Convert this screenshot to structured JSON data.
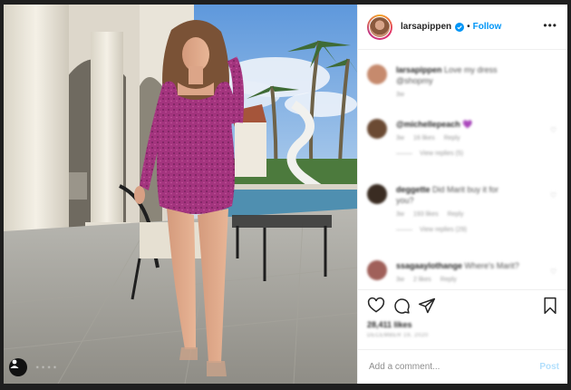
{
  "post": {
    "photo_alt": "",
    "watermark_text": "▪ ▪ ▪ ▪"
  },
  "header": {
    "username": "larsapippen",
    "separator": "•",
    "follow_label": "Follow",
    "more_label": "•••"
  },
  "comments": [
    {
      "user": "larsapippen",
      "text": "Love my dress",
      "text2": "@shopmy",
      "meta": [
        "3w"
      ],
      "replies": "",
      "avatar_color": "#c68a6d"
    },
    {
      "user": "@michellepeach",
      "text": "💜",
      "text2": "",
      "meta": [
        "3w",
        "16 likes",
        "Reply"
      ],
      "replies": "View replies (5)",
      "avatar_color": "#6b4a33"
    },
    {
      "user": "deggette",
      "text": "Did Marit buy it for",
      "text2": "you?",
      "meta": [
        "3w",
        "193 likes",
        "Reply"
      ],
      "replies": "View replies (29)",
      "avatar_color": "#3a2c22"
    },
    {
      "user": "ssagaaylothange",
      "text": "Where's Marit?",
      "text2": "",
      "meta": [
        "3w",
        "2 likes",
        "Reply"
      ],
      "replies": "",
      "avatar_color": "#a0605a"
    }
  ],
  "likes": "28,411 likes",
  "date": "DECEMBER 19, 2020",
  "add_comment": {
    "placeholder": "Add a comment...",
    "post_label": "Post"
  },
  "colors": {
    "link_blue": "#0095f6",
    "dress_pink": "#a3347e",
    "sky": "#7fb0e6"
  },
  "icons": [
    "heart-icon",
    "comment-icon",
    "share-icon",
    "bookmark-icon",
    "verified-icon",
    "tag-user-icon",
    "more-options-icon"
  ]
}
